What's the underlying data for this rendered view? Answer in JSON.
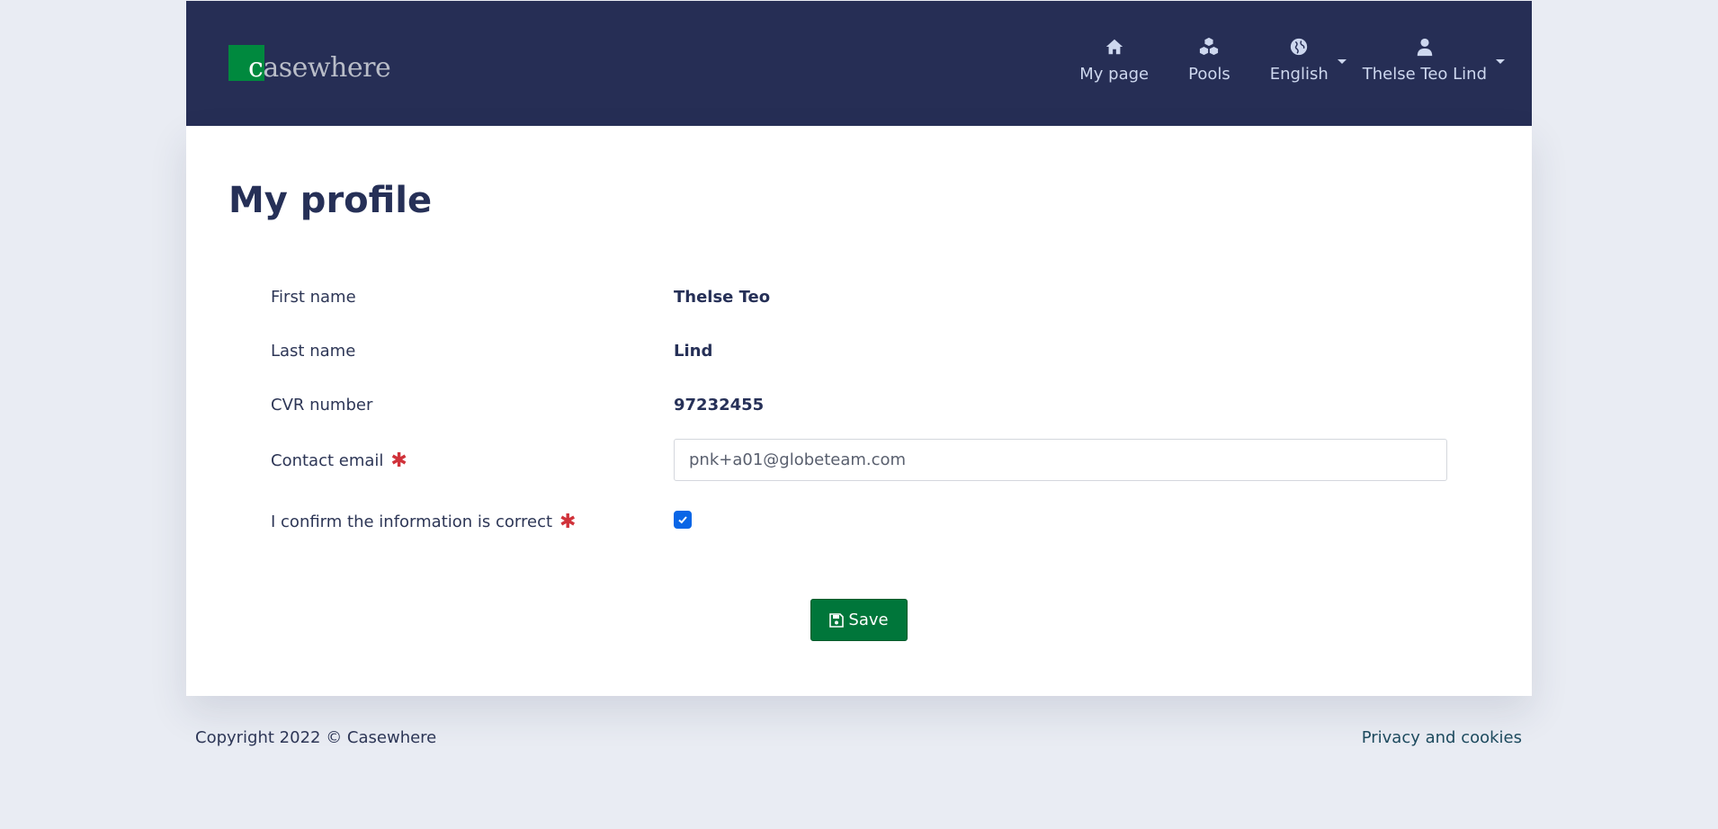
{
  "header": {
    "logo_text_first": "c",
    "logo_text_rest": "asewhere",
    "nav": [
      {
        "label": "My page",
        "icon": "home-icon"
      },
      {
        "label": "Pools",
        "icon": "cubes-icon"
      },
      {
        "label": "English",
        "icon": "globe-icon"
      },
      {
        "label": "Thelse Teo Lind",
        "icon": "user-icon"
      }
    ]
  },
  "main": {
    "title": "My profile",
    "fields": {
      "first_name_label": "First name",
      "first_name_value": "Thelse Teo",
      "last_name_label": "Last name",
      "last_name_value": "Lind",
      "cvr_label": "CVR number",
      "cvr_value": "97232455",
      "email_label": "Contact email",
      "email_value": "pnk+a01@globeteam.com",
      "confirm_label": "I confirm the information is correct",
      "required_mark": "✱"
    },
    "save_label": "Save"
  },
  "footer": {
    "copyright": "Copyright 2022 © Casewhere",
    "privacy_link": "Privacy and cookies"
  },
  "colors": {
    "header_bg": "#262e55",
    "brand_green": "#00893e",
    "save_green": "#00763a",
    "checkbox_blue": "#0a66e6",
    "required_red": "#d0323a"
  }
}
